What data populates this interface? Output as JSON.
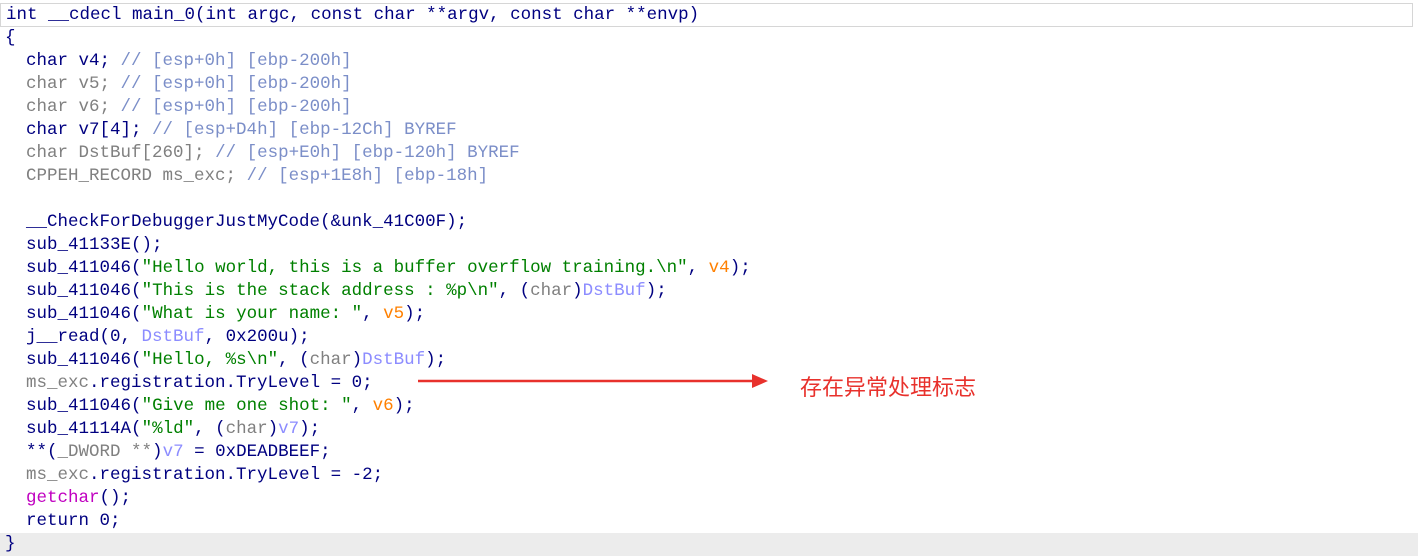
{
  "code": {
    "signature": {
      "ret": "int",
      "conv": " __cdecl ",
      "name": "main_0",
      "params": "(int argc, const char **argv, const char **envp)"
    },
    "open_brace": "{",
    "close_brace": "}",
    "decls": [
      {
        "type": "char",
        "name": " v4; ",
        "comment": "// [esp+0h] [ebp-200h]",
        "dim": false
      },
      {
        "type": "char",
        "name": " v5; ",
        "comment": "// [esp+0h] [ebp-200h]",
        "dim": true
      },
      {
        "type": "char",
        "name": " v6; ",
        "comment": "// [esp+0h] [ebp-200h]",
        "dim": true
      },
      {
        "type": "char",
        "name": " v7[4]; ",
        "comment": "// [esp+D4h] [ebp-12Ch] BYREF",
        "dim": false
      },
      {
        "type": "char",
        "name": " DstBuf[260]; ",
        "comment": "// [esp+E0h] [ebp-120h] BYREF",
        "dim": true
      },
      {
        "type": "CPPEH_RECORD",
        "name": " ms_exc; ",
        "comment": "// [esp+1E8h] [ebp-18h]",
        "dim": true
      }
    ],
    "statements": {
      "s1_fn": "__CheckForDebuggerJustMyCode",
      "s1_rest": "(&unk_41C00F);",
      "s2_fn": "sub_41133E",
      "s2_rest": "();",
      "s3_fn": "sub_411046",
      "s3_str": "\"Hello world, this is a buffer overflow training.\\n\"",
      "s3_sep": ", ",
      "s3_var": "v4",
      "s3_end": ");",
      "s4_fn": "sub_411046",
      "s4_str": "\"This is the stack address : %p\\n\"",
      "s4_sep": ", (",
      "s4_cast": "char",
      "s4_close": ")",
      "s4_var": "DstBuf",
      "s4_end": ");",
      "s5_fn": "sub_411046",
      "s5_str": "\"What is your name: \"",
      "s5_sep": ", ",
      "s5_var": "v5",
      "s5_end": ");",
      "s6_fn": "j__read",
      "s6_open": "(0, ",
      "s6_var": "DstBuf",
      "s6_end": ", 0x200u);",
      "s7_fn": "sub_411046",
      "s7_str": "\"Hello, %s\\n\"",
      "s7_sep": ", (",
      "s7_cast": "char",
      "s7_close": ")",
      "s7_var": "DstBuf",
      "s7_end": ");",
      "s8_var": "ms_exc",
      "s8_rest": ".registration.TryLevel = 0;",
      "s9_fn": "sub_411046",
      "s9_str": "\"Give me one shot: \"",
      "s9_sep": ", ",
      "s9_var": "v6",
      "s9_end": ");",
      "s10_fn": "sub_41114A",
      "s10_str": "\"%ld\"",
      "s10_sep": ", (",
      "s10_cast": "char",
      "s10_close": ")",
      "s10_var": "v7",
      "s10_end": ");",
      "s11_pre": "**(",
      "s11_cast": "_DWORD **",
      "s11_close": ")",
      "s11_var": "v7",
      "s11_end": " = 0xDEADBEEF;",
      "s12_var": "ms_exc",
      "s12_rest": ".registration.TryLevel = -2;",
      "s13_fn": "getchar",
      "s13_rest": "();",
      "s14": "return 0;"
    }
  },
  "annotation": {
    "label": "存在异常处理标志",
    "color": "#e8312c"
  }
}
